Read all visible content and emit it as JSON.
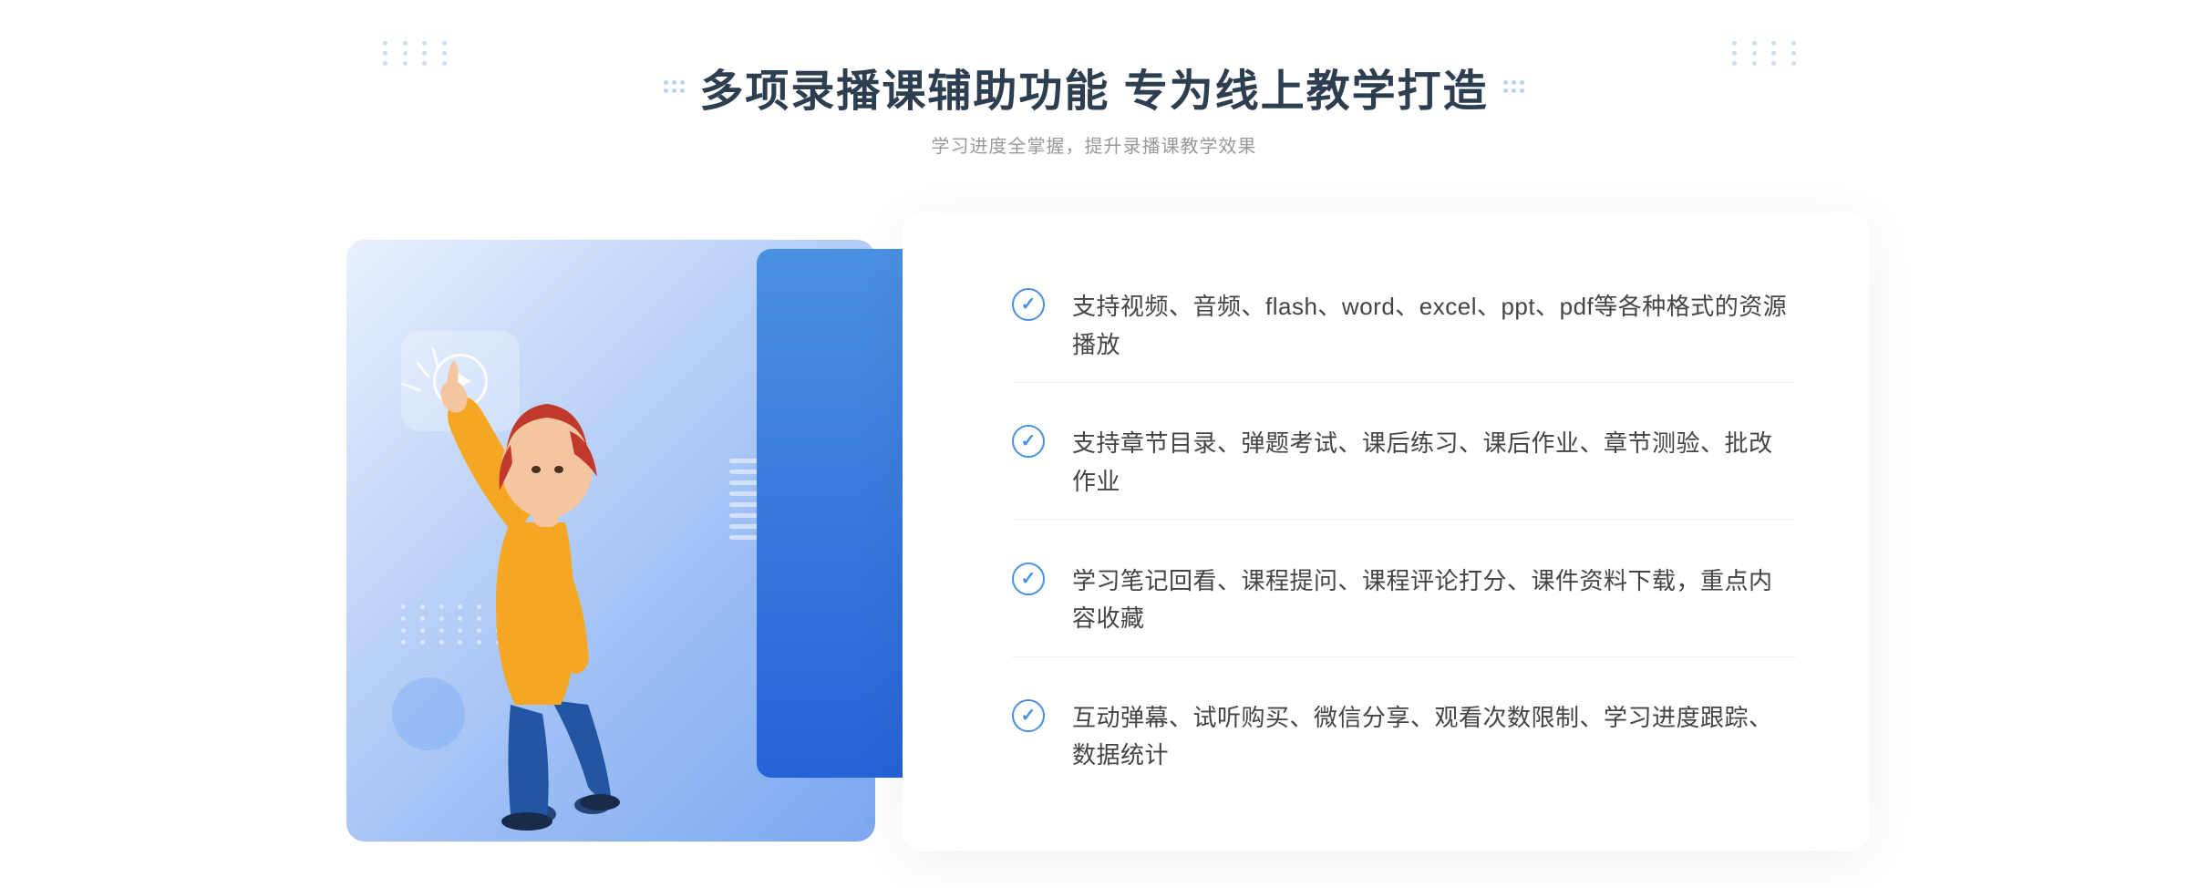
{
  "header": {
    "main_title": "多项录播课辅助功能 专为线上教学打造",
    "subtitle": "学习进度全掌握，提升录播课教学效果"
  },
  "features": [
    {
      "id": 1,
      "text": "支持视频、音频、flash、word、excel、ppt、pdf等各种格式的资源播放"
    },
    {
      "id": 2,
      "text": "支持章节目录、弹题考试、课后练习、课后作业、章节测验、批改作业"
    },
    {
      "id": 3,
      "text": "学习笔记回看、课程提问、课程评论打分、课件资料下载，重点内容收藏"
    },
    {
      "id": 4,
      "text": "互动弹幕、试听购买、微信分享、观看次数限制、学习进度跟踪、数据统计"
    }
  ],
  "decorations": {
    "left_arrow": "»",
    "check_symbol": "✓"
  },
  "colors": {
    "primary_blue": "#4a90e2",
    "dark_blue": "#2563d8",
    "title_color": "#2c3e50",
    "text_color": "#444444",
    "subtitle_color": "#999999"
  }
}
